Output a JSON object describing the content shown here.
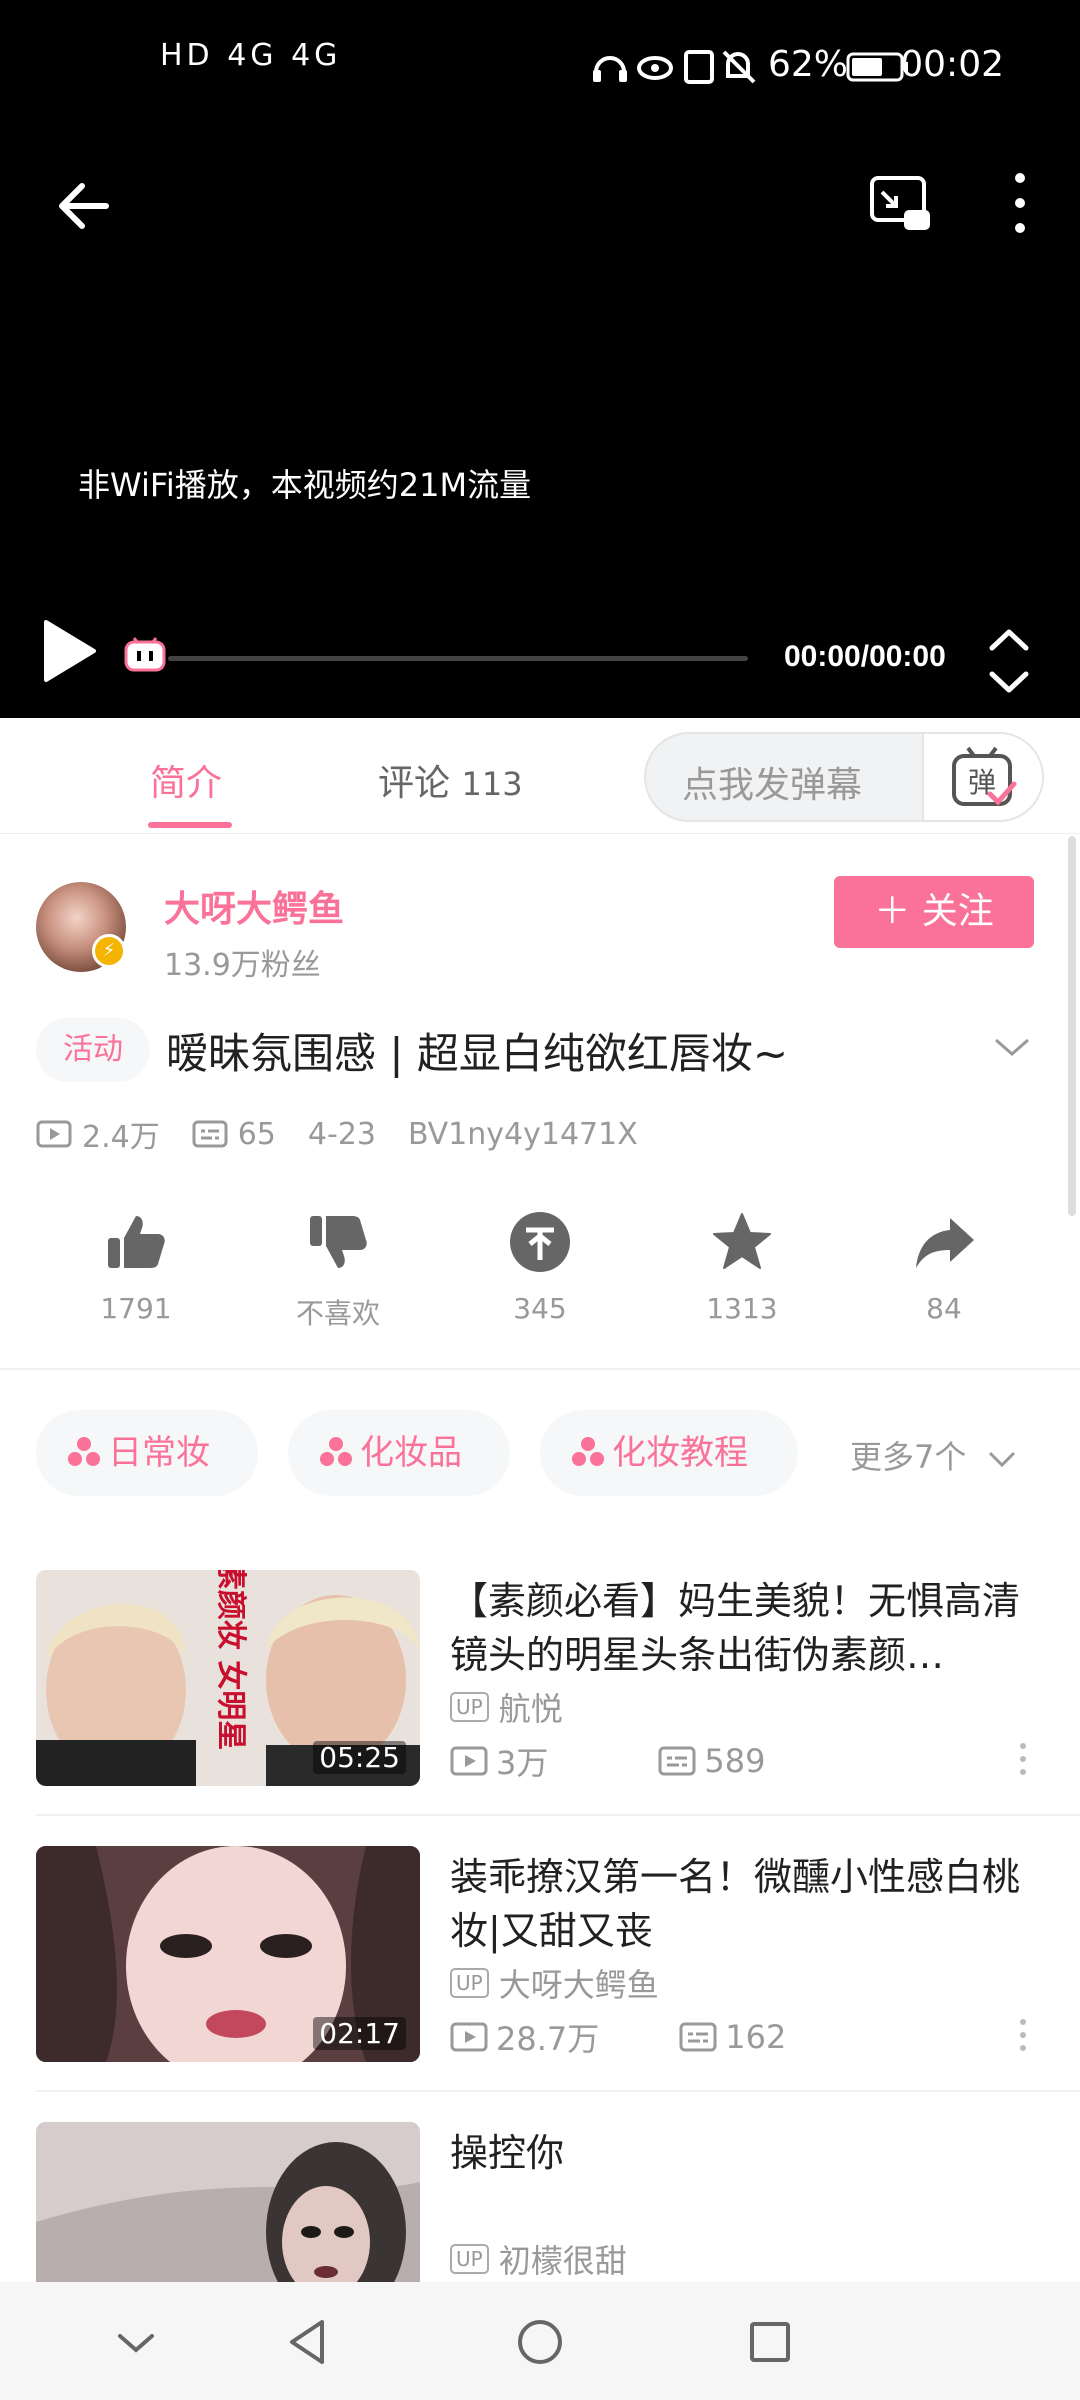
{
  "status_bar": {
    "left_icons": "HD 4G 4G",
    "battery": "62%",
    "time": "00:02"
  },
  "player": {
    "notice": "非WiFi播放，本视频约21M流量",
    "time": "00:00/00:00"
  },
  "tabs": {
    "intro": "简介",
    "comments": "评论",
    "comment_count": "113",
    "danmaku_placeholder": "点我发弹幕",
    "danmaku_icon_char": "弹"
  },
  "uploader": {
    "name": "大呀大鳄鱼",
    "fans": "13.9万粉丝",
    "follow_label": "＋ 关注"
  },
  "video": {
    "badge": "活动",
    "title": "暧昧氛围感 | 超显白纯欲红唇妆~",
    "views": "2.4万",
    "danmaku": "65",
    "date": "4-23",
    "bvid": "BV1ny4y1471X"
  },
  "actions": {
    "like": "1791",
    "dislike": "不喜欢",
    "coin": "345",
    "favorite": "1313",
    "share": "84"
  },
  "tags": [
    "日常妆",
    "化妆品",
    "化妆教程"
  ],
  "more_tags": "更多7个",
  "related": [
    {
      "title": "【素颜必看】妈生美貌！无惧高清镜头的明星头条出街伪素颜…",
      "up": "航悦",
      "views": "3万",
      "danmaku": "589",
      "duration": "05:25",
      "thumb_text": "心机伪素颜妆 女明星"
    },
    {
      "title": "装乖撩汉第一名！微醺小性感白桃妆|又甜又丧",
      "up": "大呀大鳄鱼",
      "views": "28.7万",
      "danmaku": "162",
      "duration": "02:17"
    },
    {
      "title": "操控你",
      "up": "初檬很甜"
    }
  ],
  "up_badge": "UP",
  "colors": {
    "accent": "#fb7299",
    "player_bg": "#000000",
    "muted_text": "#999999"
  }
}
